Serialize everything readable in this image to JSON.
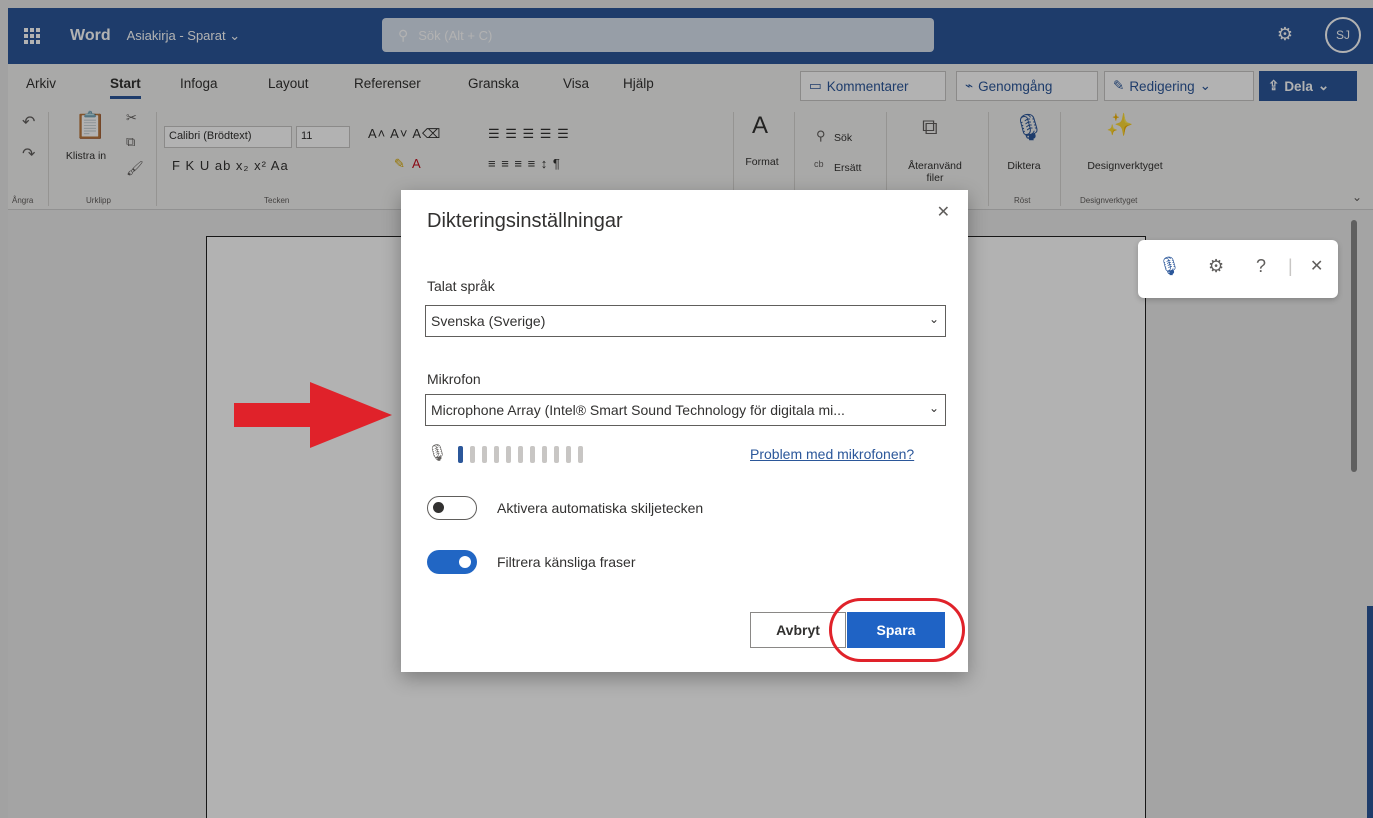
{
  "titlebar": {
    "app_name": "Word",
    "doc_name": "Asiakirja - Sparat",
    "doc_chevron": "⌄",
    "search_placeholder": "Sök (Alt + C)",
    "avatar_initials": "SJ"
  },
  "tabs": [
    {
      "label": "Arkiv"
    },
    {
      "label": "Start"
    },
    {
      "label": "Infoga"
    },
    {
      "label": "Layout"
    },
    {
      "label": "Referenser"
    },
    {
      "label": "Granska"
    },
    {
      "label": "Visa"
    },
    {
      "label": "Hjälp"
    }
  ],
  "active_tab": "Start",
  "topbar_buttons": {
    "comments": "Kommentarer",
    "review": "Genomgång",
    "editing": "Redigering",
    "share": "Dela"
  },
  "ribbon": {
    "undo_group": "Ångra",
    "clipboard": {
      "paste": "Klistra in",
      "group": "Urklipp"
    },
    "font": {
      "family": "Calibri (Brödtext)",
      "size": "11",
      "group": "Tecken",
      "row2": "F  K  U  ab  x₂  x²  Aa"
    },
    "styles": {
      "label": "Format"
    },
    "editing": {
      "search": "Sök",
      "replace": "Ersätt"
    },
    "reuse": {
      "label": "Återanvänd filer"
    },
    "voice": {
      "label": "Diktera",
      "group": "Röst"
    },
    "designer": {
      "label": "Designverktyget",
      "group": "Designverktyget"
    }
  },
  "dialog": {
    "title": "Dikteringsinställningar",
    "language_label": "Talat språk",
    "language_value": "Svenska (Sverige)",
    "mic_label": "Mikrofon",
    "mic_value": "Microphone Array (Intel® Smart Sound Technology för digitala mi...",
    "mic_problem_link": "Problem med mikrofonen?",
    "mic_level_fraction": 0.1,
    "auto_punctuation_label": "Aktivera automatiska skiljetecken",
    "auto_punctuation_on": false,
    "filter_label": "Filtrera känsliga fraser",
    "filter_on": true,
    "cancel_label": "Avbryt",
    "save_label": "Spara"
  },
  "colors": {
    "brand": "#2b579a",
    "annotation_red": "#e0222a",
    "save_blue": "#1f63c5"
  }
}
